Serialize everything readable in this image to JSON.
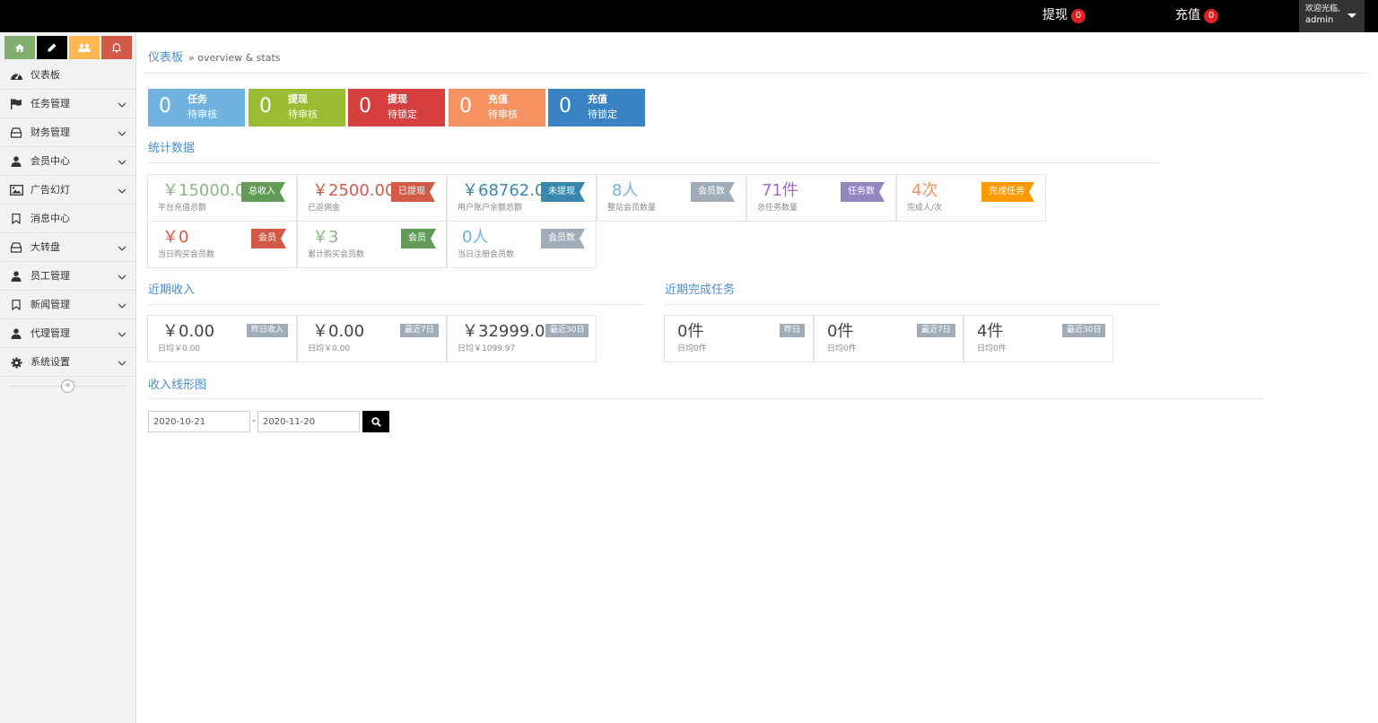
{
  "topbar": {
    "withdraw": {
      "label": "提现",
      "count": "0"
    },
    "recharge": {
      "label": "充值",
      "count": "0"
    },
    "user": {
      "welcome": "欢迎光临,",
      "name": "admin"
    }
  },
  "sidebar": {
    "shortcut_icons": [
      "home-icon",
      "pencil-icon",
      "users-icon",
      "bell-icon"
    ],
    "items": [
      {
        "label": "仪表板",
        "icon": "dashboard-icon",
        "expandable": false
      },
      {
        "label": "任务管理",
        "icon": "flag-icon",
        "expandable": true
      },
      {
        "label": "财务管理",
        "icon": "inbox-icon",
        "expandable": true
      },
      {
        "label": "会员中心",
        "icon": "user-icon",
        "expandable": true
      },
      {
        "label": "广告幻灯",
        "icon": "image-icon",
        "expandable": true
      },
      {
        "label": "消息中心",
        "icon": "bookmark-icon",
        "expandable": false
      },
      {
        "label": "大转盘",
        "icon": "inbox-icon",
        "expandable": true
      },
      {
        "label": "员工管理",
        "icon": "user-icon",
        "expandable": true
      },
      {
        "label": "新闻管理",
        "icon": "bookmark-icon",
        "expandable": true
      },
      {
        "label": "代理管理",
        "icon": "user-icon",
        "expandable": true
      },
      {
        "label": "系统设置",
        "icon": "gear-icon",
        "expandable": true
      }
    ],
    "collapse_glyph": "«"
  },
  "breadcrumb": {
    "title": "仪表板",
    "subtitle": "» overview & stats"
  },
  "tiles": [
    {
      "num": "0",
      "line1": "任务",
      "line2": "待审核"
    },
    {
      "num": "0",
      "line1": "提现",
      "line2": "待审核"
    },
    {
      "num": "0",
      "line1": "提现",
      "line2": "待锁定"
    },
    {
      "num": "0",
      "line1": "充值",
      "line2": "待审核"
    },
    {
      "num": "0",
      "line1": "充值",
      "line2": "待锁定"
    }
  ],
  "stats": {
    "title": "统计数据",
    "cards": [
      {
        "value": "￥15000.00",
        "label": "平台充值总额",
        "ribbon": "总收入"
      },
      {
        "value": "￥2500.00",
        "label": "已返佣金",
        "ribbon": "已提现"
      },
      {
        "value": "￥68762.00",
        "label": "用户账户余额总额",
        "ribbon": "未提现"
      },
      {
        "value": "8人",
        "label": "整站会员数量",
        "ribbon": "会员数"
      },
      {
        "value": "71件",
        "label": "总任务数量",
        "ribbon": "任务数"
      },
      {
        "value": "4次",
        "label": "完成人/次",
        "ribbon": "完成任务"
      },
      {
        "value": "￥0",
        "label": "当日购买会员数",
        "ribbon": "会员"
      },
      {
        "value": "￥3",
        "label": "累计购买会员数",
        "ribbon": "会员"
      },
      {
        "value": "0人",
        "label": "当日注册会员数",
        "ribbon": "会员数"
      }
    ]
  },
  "income": {
    "title": "近期收入",
    "cards": [
      {
        "value": "￥0.00",
        "label": "日均￥0.00",
        "tag": "昨日收入"
      },
      {
        "value": "￥0.00",
        "label": "日均￥0.00",
        "tag": "最近7日"
      },
      {
        "value": "￥32999.00",
        "label": "日均￥1099.97",
        "tag": "最近30日"
      }
    ]
  },
  "tasks": {
    "title": "近期完成任务",
    "cards": [
      {
        "value": "0件",
        "label": "日均0件",
        "tag": "昨日"
      },
      {
        "value": "0件",
        "label": "日均0件",
        "tag": "最近7日"
      },
      {
        "value": "4件",
        "label": "日均0件",
        "tag": "最近30日"
      }
    ]
  },
  "chart_section": {
    "title": "收入线形图",
    "start_date": "2020-10-21",
    "end_date": "2020-11-20",
    "separator": "-"
  },
  "colors": {
    "accent": "#4b8ec8",
    "tile_task": "#6fb3e0",
    "tile_withdraw_review": "#9abc32",
    "tile_withdraw_lock": "#d53f40",
    "tile_recharge_review": "#f79263",
    "tile_recharge_lock": "#3983c2"
  }
}
